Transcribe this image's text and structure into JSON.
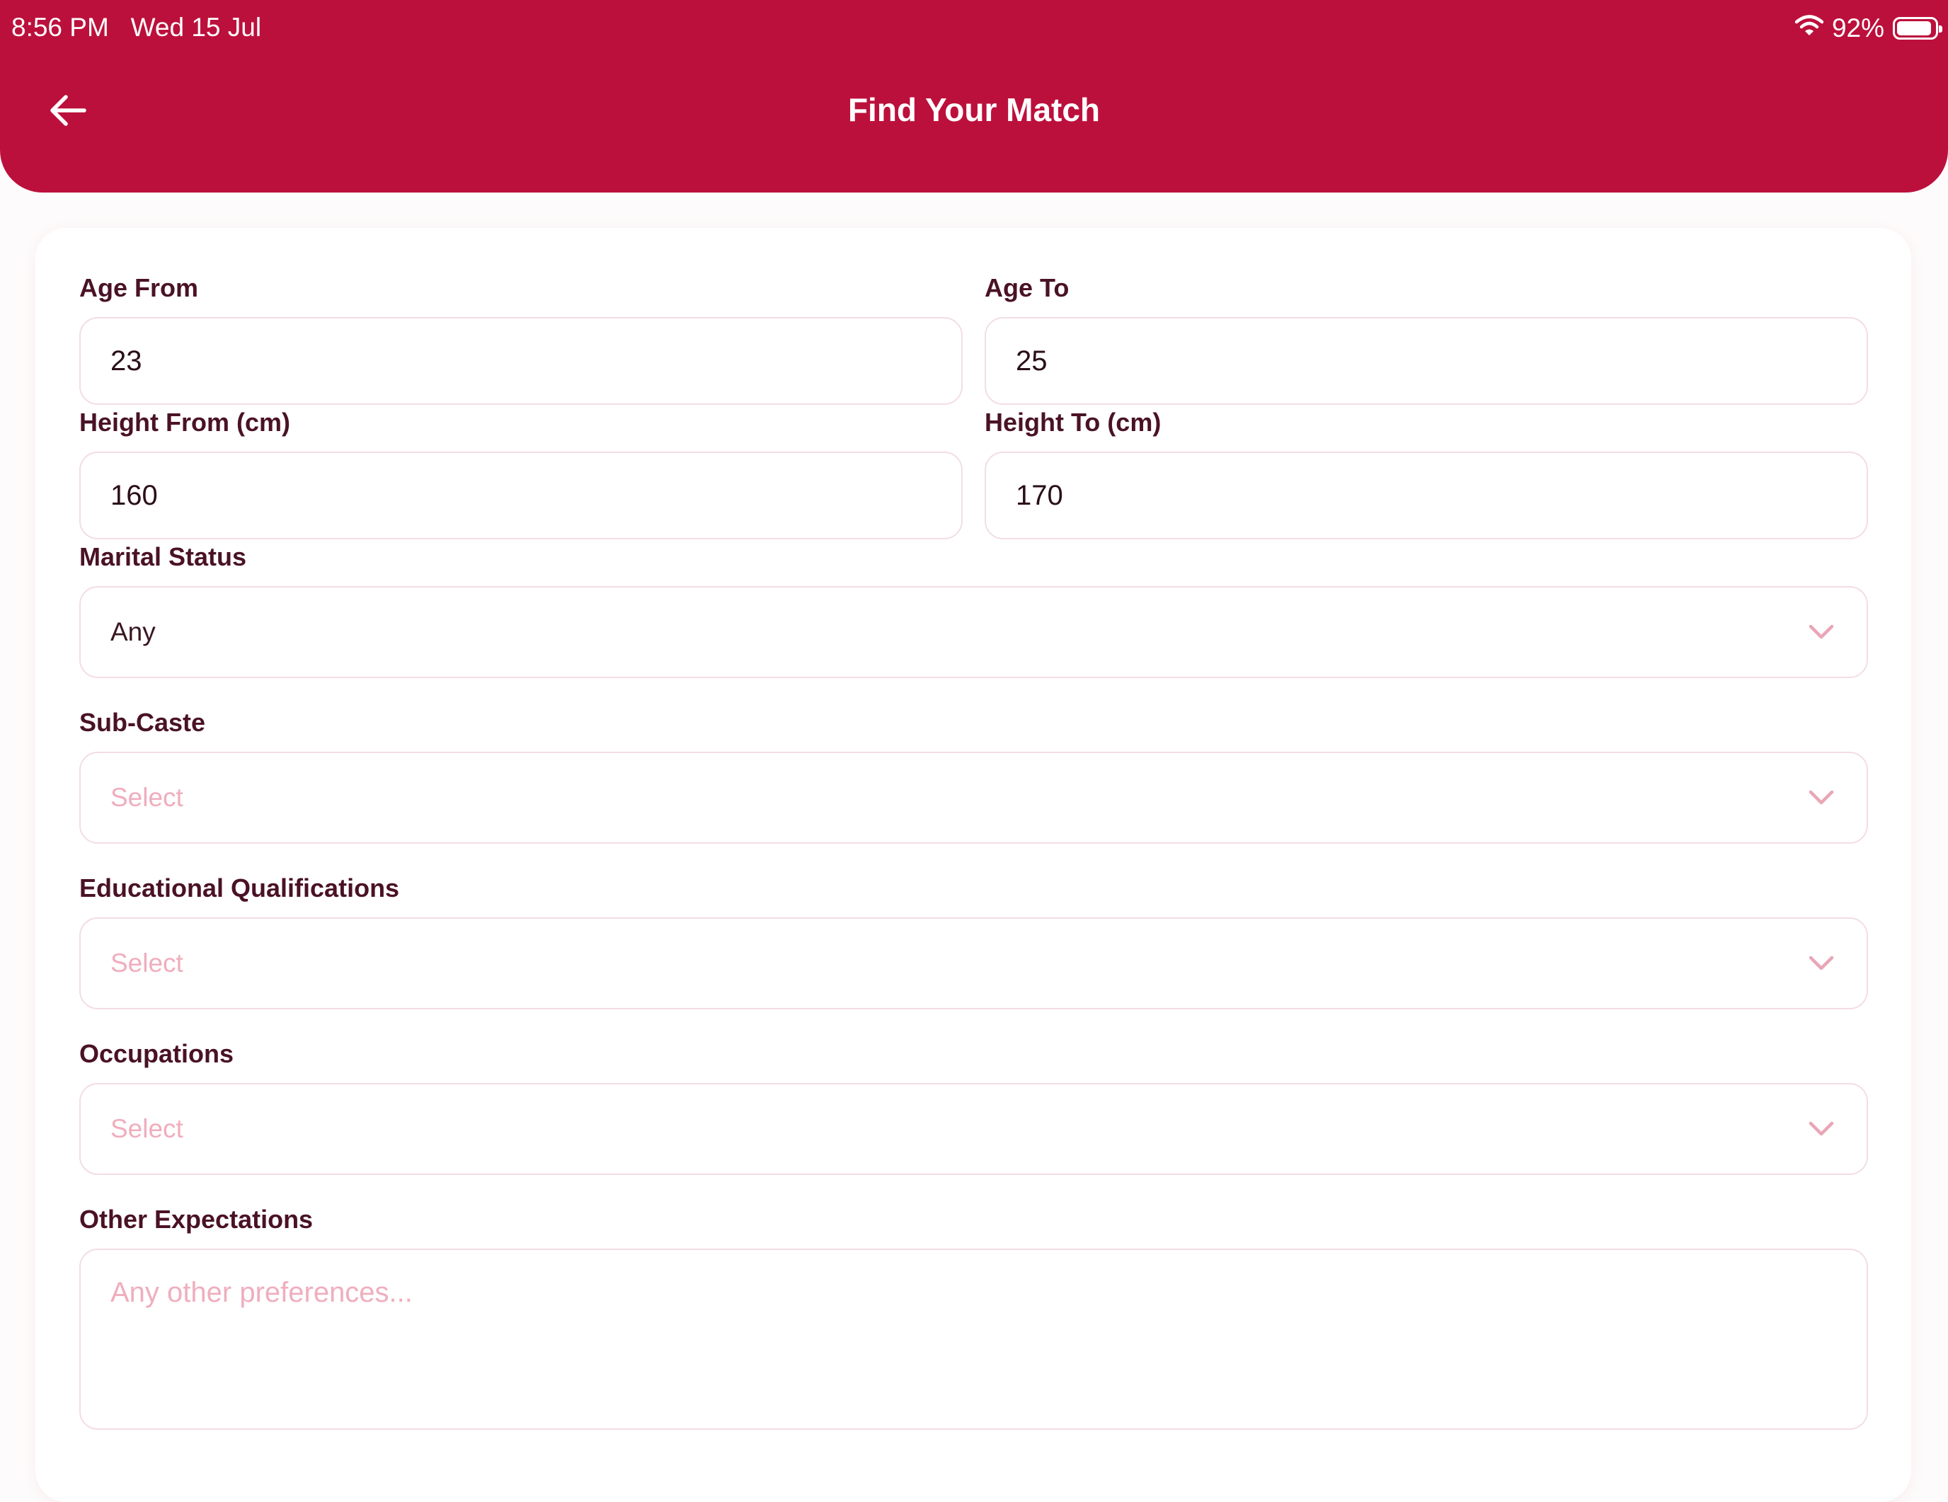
{
  "status_bar": {
    "time": "8:56 PM",
    "date": "Wed 15 Jul",
    "battery": "92%",
    "battery_level": 0.92
  },
  "header": {
    "title": "Find Your Match",
    "back_icon": "arrow-left-icon"
  },
  "colors": {
    "brand": "#bc103c",
    "label": "#4a1226",
    "placeholder": "#efaebd",
    "border": "#f3dde3"
  },
  "form": {
    "age_from": {
      "label": "Age From",
      "value": "23"
    },
    "age_to": {
      "label": "Age To",
      "value": "25"
    },
    "height_from": {
      "label": "Height From (cm)",
      "value": "160"
    },
    "height_to": {
      "label": "Height To (cm)",
      "value": "170"
    },
    "marital_status": {
      "label": "Marital Status",
      "value": "Any",
      "icon": "chevron-down-icon"
    },
    "sub_caste": {
      "label": "Sub-Caste",
      "placeholder": "Select",
      "icon": "chevron-down-icon"
    },
    "education": {
      "label": "Educational Qualifications",
      "placeholder": "Select",
      "icon": "chevron-down-icon"
    },
    "occupations": {
      "label": "Occupations",
      "placeholder": "Select",
      "icon": "chevron-down-icon"
    },
    "other_expectations": {
      "label": "Other Expectations",
      "placeholder": "Any other preferences..."
    }
  }
}
